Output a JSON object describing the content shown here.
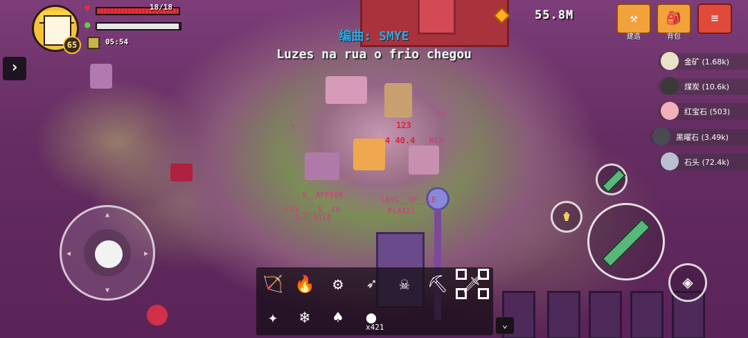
{
  "hud": {
    "level": "65",
    "hp_text": "18/18",
    "hp_fraction": 1.0,
    "energy_fraction": 0.98,
    "timer": "05:54",
    "currency": "55.8M"
  },
  "top_buttons": [
    {
      "label": "建造",
      "icon": "build-icon"
    },
    {
      "label": "背包",
      "icon": "backpack-icon"
    },
    {
      "label": "",
      "icon": "scroll-menu-icon"
    }
  ],
  "music": {
    "credit": "编曲: SMYE",
    "lyric": "Luzes na rua o frio chegou"
  },
  "resources": [
    {
      "text": "金矿 (1.68k)",
      "icon": "gold-ore-icon",
      "color": "#e8e2c8"
    },
    {
      "text": "煤炭 (10.6k)",
      "icon": "coal-icon",
      "color": "#3a3a3a"
    },
    {
      "text": "红宝石 (503)",
      "icon": "ruby-icon",
      "color": "#f0b0b8"
    },
    {
      "text": "黑曜石 (3.49k)",
      "icon": "obsidian-icon",
      "color": "#4a4a55"
    },
    {
      "text": "石头 (72.4k)",
      "icon": "stone-icon",
      "color": "#b8c0d0"
    }
  ],
  "world_text": {
    "tags": [
      "S__AFFSOR",
      "LAYC__OF__LE",
      "CAY____S__CK",
      "FLAX21",
      "D-C_NILS",
      "T",
      "NER",
      "EV"
    ],
    "damage": [
      "123",
      "4 40.4"
    ]
  },
  "hotbar": {
    "slots": [
      {
        "icon": "crossbow-icon",
        "glyph": "🏹"
      },
      {
        "icon": "fire-staff-icon",
        "glyph": "🔥"
      },
      {
        "icon": "drill-icon",
        "glyph": "⚙"
      },
      {
        "icon": "bow-icon",
        "glyph": "➶"
      },
      {
        "icon": "skull-staff-icon",
        "glyph": "☠"
      },
      {
        "icon": "pickaxe-icon",
        "glyph": "⛏"
      },
      {
        "icon": "green-sword-icon",
        "glyph": "🗡"
      },
      {
        "icon": "golden-staff-icon",
        "glyph": "✦"
      },
      {
        "icon": "ice-staff-icon",
        "glyph": "❄"
      },
      {
        "icon": "shovel-icon",
        "glyph": "♠"
      },
      {
        "icon": "bomb-item-icon",
        "glyph": "●"
      }
    ],
    "item_count": "x421",
    "selected_index": 6
  },
  "colors": {
    "hp": "#e2303a",
    "accent_orange": "#f2a23a",
    "song_blue": "#2fa8e0"
  }
}
